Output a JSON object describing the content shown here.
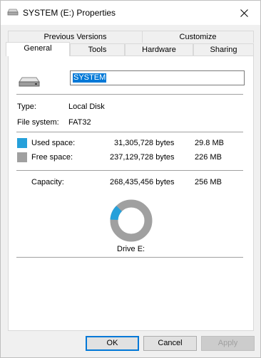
{
  "window": {
    "title": "SYSTEM (E:) Properties"
  },
  "tabs_row1": [
    {
      "label": "Previous Versions"
    },
    {
      "label": "Customize"
    }
  ],
  "tabs_row2": [
    {
      "label": "General",
      "active": true
    },
    {
      "label": "Tools"
    },
    {
      "label": "Hardware"
    },
    {
      "label": "Sharing"
    }
  ],
  "general": {
    "drive_name_value": "SYSTEM",
    "type_label": "Type:",
    "type_value": "Local Disk",
    "fs_label": "File system:",
    "fs_value": "FAT32",
    "used": {
      "label": "Used space:",
      "bytes": "31,305,728 bytes",
      "size": "29.8 MB",
      "color": "#26a0da"
    },
    "free": {
      "label": "Free space:",
      "bytes": "237,129,728 bytes",
      "size": "226 MB",
      "color": "#a0a0a0"
    },
    "capacity": {
      "label": "Capacity:",
      "bytes": "268,435,456 bytes",
      "size": "256 MB"
    },
    "used_fraction": 0.1166,
    "drive_label": "Drive E:"
  },
  "buttons": {
    "ok": "OK",
    "cancel": "Cancel",
    "apply": "Apply"
  },
  "icons": {
    "title": "drive-icon",
    "close": "close-icon",
    "drive": "hard-drive-icon"
  }
}
